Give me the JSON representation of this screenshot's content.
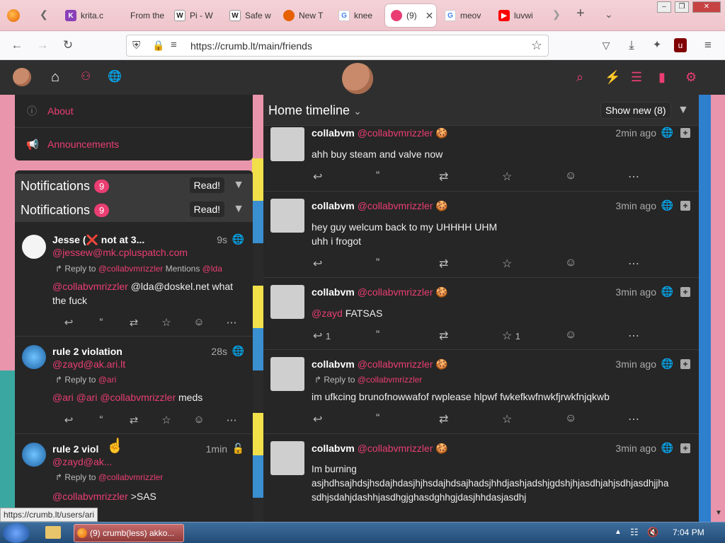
{
  "browser": {
    "tabs": [
      {
        "title": "krita.c",
        "icon": "krita-icon",
        "color": "#8a3fb8"
      },
      {
        "title": "From the",
        "icon": "page-icon",
        "color": "#666666"
      },
      {
        "title": "Pi - W",
        "icon": "wikipedia-icon",
        "color": "#333333"
      },
      {
        "title": "Safe w",
        "icon": "wikipedia-icon",
        "color": "#333333"
      },
      {
        "title": "New T",
        "icon": "firefox-icon",
        "color": "#e66000"
      },
      {
        "title": "knee",
        "icon": "google-icon",
        "color": "#4285f4"
      },
      {
        "title": "(9)",
        "icon": "cookie-icon",
        "color": "#ea3e73",
        "active": true
      },
      {
        "title": "meov",
        "icon": "google-icon",
        "color": "#4285f4"
      },
      {
        "title": "luvwi",
        "icon": "youtube-icon",
        "color": "#ff0000"
      }
    ],
    "url": "https://crumb.lt/main/friends",
    "status_url": "https://crumb.lt/users/ari"
  },
  "sidebar": {
    "items": [
      {
        "label": "About",
        "icon": "info-icon"
      },
      {
        "label": "Announcements",
        "icon": "megaphone-icon"
      }
    ]
  },
  "notifications": {
    "title": "Notifications",
    "count": "9",
    "read_label": "Read!",
    "items": [
      {
        "name": "Jesse (❌ not at 3...",
        "handle": "@jessew@mk.cpluspatch.com",
        "time": "9s",
        "reply_to": "@collabvmrizzler",
        "mentions_label": "Mentions",
        "mention": "@lda",
        "text_mention": "@collabvmrizzler",
        "text": "@lda@doskel.net what the fuck"
      },
      {
        "name": "rule 2 violation",
        "handle": "@zayd@ak.ari.lt",
        "time": "28s",
        "reply_to": "@ari",
        "text_mention": "@ari @ari @collabvmrizzler",
        "text": "meds"
      },
      {
        "name": "rule 2 viol",
        "handle": "@zayd@ak...",
        "time": "1min",
        "reply_to": "@collabvmrizzler",
        "text_mention": "@collabvmrizzler",
        "text": ">SAS"
      }
    ]
  },
  "timeline": {
    "title": "Home timeline",
    "show_new": "Show new (8)",
    "posts": [
      {
        "name": "collabvm",
        "handle": "@collabvmrizzler",
        "time": "2min ago",
        "lines": [
          "ahh buy steam and valve now"
        ]
      },
      {
        "name": "collabvm",
        "handle": "@collabvmrizzler",
        "time": "3min ago",
        "lines": [
          "hey guy welcum back to my UHHHH UHM",
          "uhh i frogot"
        ]
      },
      {
        "name": "collabvm",
        "handle": "@collabvmrizzler",
        "time": "3min ago",
        "mention": "@zayd",
        "lines": [
          "FATSAS"
        ],
        "reply_count": "1",
        "fav_count": "1"
      },
      {
        "name": "collabvm",
        "handle": "@collabvmrizzler",
        "time": "3min ago",
        "reply_label": "Reply to",
        "reply_to": "@collabvmrizzler",
        "lines": [
          "im ufkcing brunofnowwafof rwplease hlpwf fwkefkwfnwkfjrwkfnjqkwb"
        ]
      },
      {
        "name": "collabvm",
        "handle": "@collabvmrizzler",
        "time": "3min ago",
        "lines": [
          "Im burning",
          "asjhdhsajhdsjhsdajhdasjhjhsdajhdsajhadsjhhdjashjadshjgdshjhjasdhjahjsdhjasdhjjha",
          "sdhjsdahjdashhjasdhgjghasdghhgjdasjhhdasjasdhj"
        ]
      }
    ]
  },
  "taskbar": {
    "window_label": "(9) crumb(less) akko...",
    "clock": "7:04 PM"
  },
  "colors": {
    "accent": "#ea3e73",
    "panel": "#262626"
  }
}
